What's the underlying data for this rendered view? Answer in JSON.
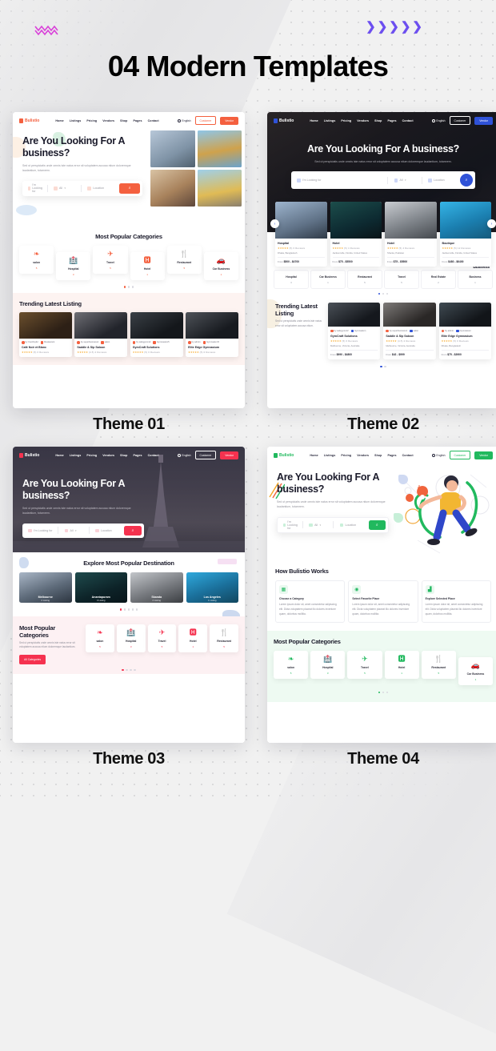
{
  "header": {
    "title": "04 Modern Templates",
    "deco_left": "zigzag-ornament",
    "deco_left_glyph": "〰〰",
    "deco_right": "chevrons-ornament",
    "deco_right_glyph": "❯❯❯❯❯",
    "accent_left_color": "#d93fd9",
    "accent_right_color": "#6c4ef0"
  },
  "common": {
    "brand": "Bulistio",
    "nav_links": [
      "Home",
      "Listings",
      "Pricing",
      "Vendors",
      "Shop",
      "Pages",
      "Contact"
    ],
    "language": "English",
    "btn_customer": "Customer",
    "btn_vendor": "Vendor",
    "hero_heading": "Are You Looking For A business?",
    "hero_paragraph": "Sed ut perspiciatis unde omnis iste natus error sit voluptatem accusa ntium doloremque laudantium, totamrem.",
    "search_placeholder": "I'm Looking for",
    "search_category": "All",
    "search_location": "Location",
    "search_icon": "search-icon"
  },
  "themes": [
    {
      "label": "Theme 01",
      "accent": "#f4603f",
      "sections": {
        "categories_title": "Most Popular Categories",
        "categories": [
          {
            "name": "salon",
            "count": "5",
            "icon": "lotus-icon"
          },
          {
            "name": "Hospital",
            "count": "3",
            "icon": "hospital-icon"
          },
          {
            "name": "Travel",
            "count": "5",
            "icon": "plane-icon"
          },
          {
            "name": "Hotel",
            "count": "1",
            "icon": "hotel-icon"
          },
          {
            "name": "Restaurant",
            "count": "5",
            "icon": "restaurant-icon"
          },
          {
            "name": "Car Business",
            "count": "1",
            "icon": "car-icon"
          }
        ],
        "trending_title": "Trending Latest Listing",
        "listings": [
          {
            "name": "Café Noir et Blanc",
            "author": "by CoolJoyful",
            "tag": "Restaurant",
            "rating": "★★★★★",
            "reviews": "(5) 0 Reviews"
          },
          {
            "name": "Saddle & Sip Saloon",
            "author": "by superbusiness1",
            "tag": "salon",
            "rating": "★★★★★",
            "reviews": "(4.5) 2 Reviews"
          },
          {
            "name": "GymCraft Solutions",
            "author": "by safegyms12",
            "tag": "Gymnasium5",
            "rating": "★★★★★",
            "reviews": "(5) 0 Reviews"
          },
          {
            "name": "Elite Edge Gymnasium",
            "author": "by admin",
            "tag": "Gymnasium5",
            "rating": "★★★★★",
            "reviews": "(5) 0 Reviews"
          }
        ]
      }
    },
    {
      "label": "Theme 02",
      "accent": "#2f52d8",
      "sections": {
        "cities": [
          {
            "name": "Hospital",
            "rating": "★★★★★",
            "reviews": "(5) 0 Reviews",
            "location": "Dhaka, Bangladesh",
            "price_label": "From",
            "price": "$500 - $4700"
          },
          {
            "name": "Hotel",
            "rating": "★★★★★",
            "reviews": "(5) 4 Reviews",
            "location": "Jacksonville, Florida, United States",
            "price_label": "From",
            "price": "$75 - $5500"
          },
          {
            "name": "Hotel",
            "rating": "★★★★★",
            "reviews": "(5) 4 Reviews",
            "location": "Shanta, Pakistan",
            "price_label": "From",
            "price": "$75 - $5500"
          },
          {
            "name": "Boutique",
            "rating": "★★★★★",
            "reviews": "(5) 12 Reviews",
            "location": "Jacksonville, Florida, United States",
            "price_label": "From",
            "price": "$480 - $6400"
          }
        ],
        "categories_title": "Business",
        "categories": [
          {
            "name": "Hospital",
            "count": "3"
          },
          {
            "name": "Car Business",
            "count": "1"
          },
          {
            "name": "Restaurant",
            "count": "5"
          },
          {
            "name": "Travel",
            "count": "5"
          },
          {
            "name": "Real Estate",
            "count": "2"
          },
          {
            "name": "Business",
            "count": "1"
          }
        ],
        "trending_title": "Trending Latest Listing",
        "trending_sub": "Sed ut perspiciatis unde omnis iste natus error sit voluptatem accusa ntium.",
        "listings": [
          {
            "name": "GymCraft Solutions",
            "author": "by safegyms12",
            "tag": "Gymnasium",
            "rating": "★★★★★",
            "reviews": "(5) 0 Reviews",
            "location": "Melbourne, Victoria, Australia",
            "price_label": "From",
            "price": "$990 - $4800"
          },
          {
            "name": "Saddle & Sip Saloon",
            "author": "by superbusiness1",
            "tag": "salon",
            "rating": "★★★★★",
            "reviews": "(4.5) 2 Reviews",
            "location": "Melbourne, Victoria, Australia",
            "price_label": "From",
            "price": "$42 - $999"
          },
          {
            "name": "Elite Edge Gymnasium",
            "author": "by admin",
            "tag": "Gymnasium",
            "rating": "★★★★★",
            "reviews": "(5) 0 Reviews",
            "location": "Dhaka, Bangladesh",
            "price_label": "From",
            "price": "$75 - $3900"
          }
        ]
      }
    },
    {
      "label": "Theme 03",
      "accent": "#f5324f",
      "sections": {
        "destination_title": "Explore Most Popular Destination",
        "destinations": [
          {
            "name": "Melbourne",
            "count": "2 Listing"
          },
          {
            "name": "Anantapuram",
            "count": "3 Listing"
          },
          {
            "name": "Skanda",
            "count": "2 Listing"
          },
          {
            "name": "Los Angeles",
            "count": "1 Listing"
          }
        ],
        "categories_title": "Most Popular Categories",
        "categories_sub": "Sed ut perspiciatis unde omnis iste natus error sit voluptatem accusa ntium doloremque laudantium.",
        "categories_button": "All Categories",
        "categories": [
          {
            "name": "salon",
            "count": "5",
            "icon": "lotus-icon"
          },
          {
            "name": "Hospital",
            "count": "3",
            "icon": "hospital-icon"
          },
          {
            "name": "Travel",
            "count": "5",
            "icon": "plane-icon"
          },
          {
            "name": "Hotel",
            "count": "1",
            "icon": "hotel-icon"
          },
          {
            "name": "Restaurant",
            "count": "5",
            "icon": "restaurant-icon"
          }
        ]
      }
    },
    {
      "label": "Theme 04",
      "accent": "#21b95e",
      "sections": {
        "works_title": "How Bulistio Works",
        "steps": [
          {
            "title": "Choose a Category",
            "text": "Lorem ipsum dolor sit, amet consectetur adipiscing elit. Dicta voluptatem placeat illo dolores inventore quam, dolorbus mollitia.",
            "icon": "grid-icon"
          },
          {
            "title": "Select Favorite Place",
            "text": "Lorem ipsum dolor sit, amet consectetur adipiscing elit. Dicta voluptatem placeat illo dolores inventore quam, dolorbus mollitia.",
            "icon": "pin-icon"
          },
          {
            "title": "Explore Selected Place",
            "text": "Lorem ipsum dolor sit, amet consectetur adipiscing elit. Dicta voluptatem placeat illo dolores inventore quam, dolorbus mollitia.",
            "icon": "chart-icon"
          }
        ],
        "categories_title": "Most Popular Categories",
        "categories": [
          {
            "name": "salon",
            "count": "5",
            "icon": "lotus-icon"
          },
          {
            "name": "Hospital",
            "count": "3",
            "icon": "hospital-icon"
          },
          {
            "name": "Travel",
            "count": "5",
            "icon": "plane-icon"
          },
          {
            "name": "Hotel",
            "count": "1",
            "icon": "hotel-icon"
          },
          {
            "name": "Restaurant",
            "count": "5",
            "icon": "restaurant-icon"
          },
          {
            "name": "Car Business",
            "count": "1",
            "icon": "car-icon"
          }
        ]
      }
    }
  ]
}
